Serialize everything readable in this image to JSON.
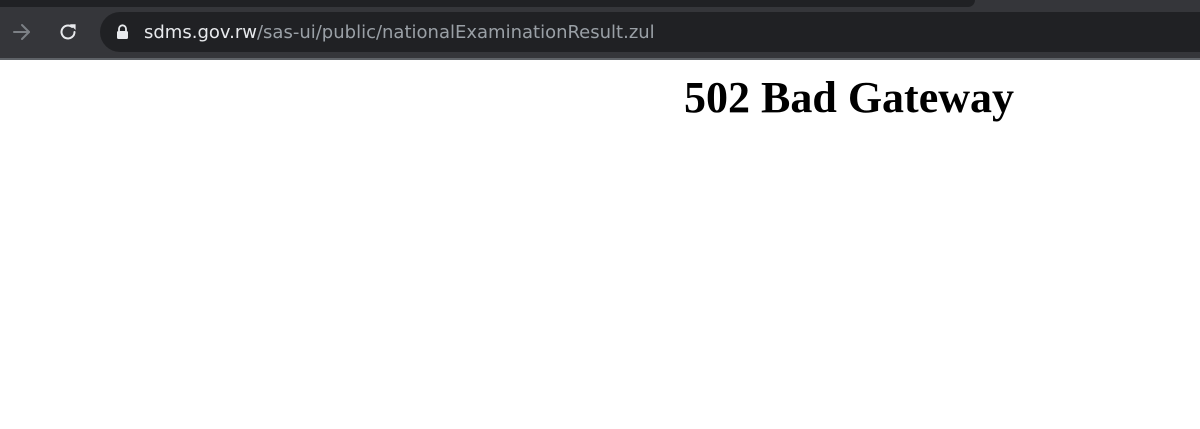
{
  "browser": {
    "url_host": "sdms.gov.rw",
    "url_path": "/sas-ui/public/nationalExaminationResult.zul"
  },
  "page": {
    "title": "502 Bad Gateway"
  }
}
